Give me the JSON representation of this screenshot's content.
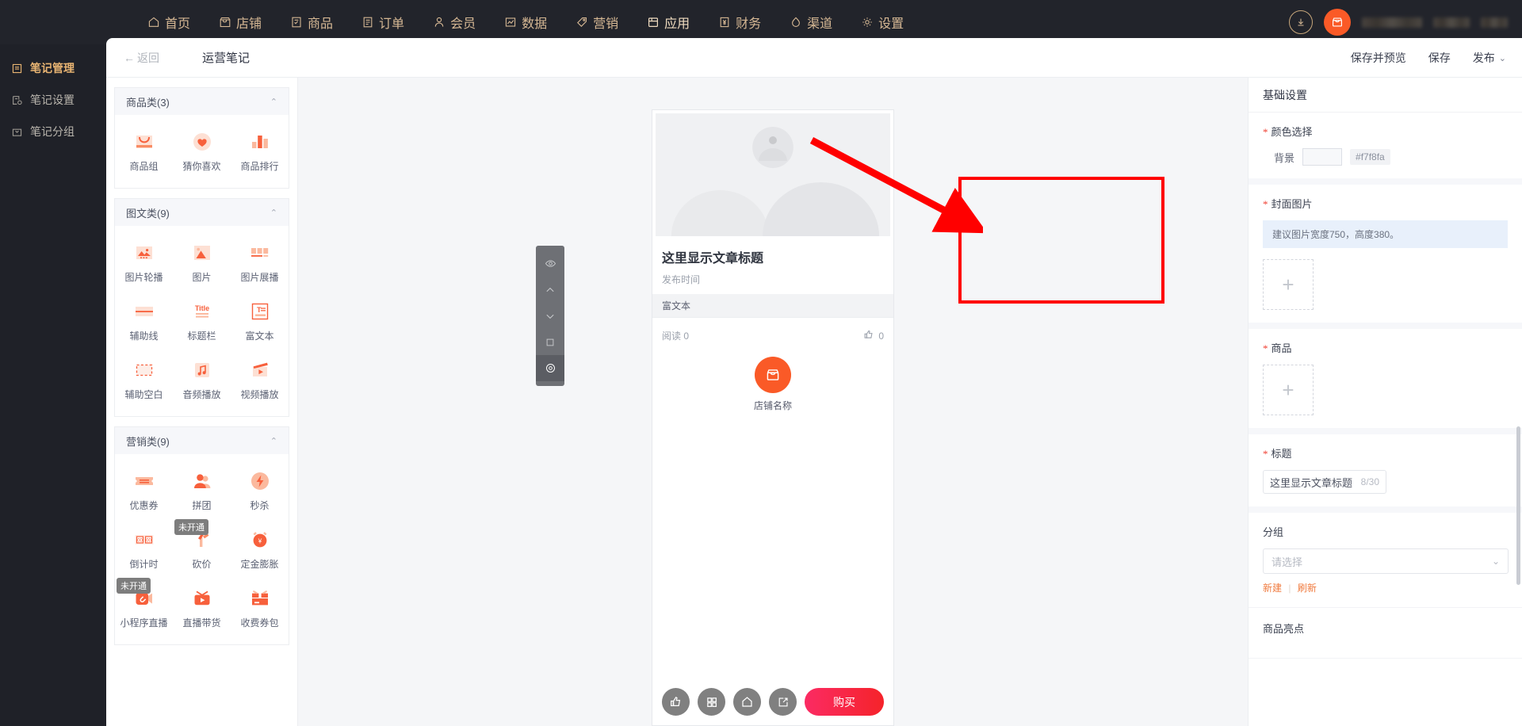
{
  "topnav": {
    "items": [
      {
        "label": "首页",
        "icon": "home-icon",
        "active": false
      },
      {
        "label": "店铺",
        "icon": "store-icon",
        "active": false
      },
      {
        "label": "商品",
        "icon": "goods-icon",
        "active": false
      },
      {
        "label": "订单",
        "icon": "order-icon",
        "active": false
      },
      {
        "label": "会员",
        "icon": "member-icon",
        "active": false
      },
      {
        "label": "数据",
        "icon": "chart-icon",
        "active": false
      },
      {
        "label": "营销",
        "icon": "tag-icon",
        "active": false
      },
      {
        "label": "应用",
        "icon": "apps-icon",
        "active": true
      },
      {
        "label": "财务",
        "icon": "finance-icon",
        "active": false
      },
      {
        "label": "渠道",
        "icon": "channel-icon",
        "active": false
      },
      {
        "label": "设置",
        "icon": "gear-icon",
        "active": false
      }
    ],
    "download_icon": "download-icon",
    "avatar_icon": "store-avatar-icon"
  },
  "rail": {
    "items": [
      {
        "label": "笔记管理",
        "icon": "note-list-icon",
        "active": true
      },
      {
        "label": "笔记设置",
        "icon": "note-settings-icon",
        "active": false
      },
      {
        "label": "笔记分组",
        "icon": "note-group-icon",
        "active": false
      }
    ]
  },
  "header": {
    "back_label": "返回",
    "title": "运营笔记",
    "save_preview_label": "保存并预览",
    "save_label": "保存",
    "publish_label": "发布"
  },
  "components": {
    "groups": [
      {
        "title": "商品类(3)",
        "collapse_icon": "chevron-up-icon",
        "items": [
          {
            "label": "商品组",
            "icon": "goods-group-icon",
            "badge": ""
          },
          {
            "label": "猜你喜欢",
            "icon": "heart-icon",
            "badge": ""
          },
          {
            "label": "商品排行",
            "icon": "bar-rank-icon",
            "badge": ""
          }
        ]
      },
      {
        "title": "图文类(9)",
        "collapse_icon": "chevron-up-icon",
        "items": [
          {
            "label": "图片轮播",
            "icon": "carousel-icon",
            "badge": ""
          },
          {
            "label": "图片",
            "icon": "image-icon",
            "badge": ""
          },
          {
            "label": "图片展播",
            "icon": "image-show-icon",
            "badge": ""
          },
          {
            "label": "辅助线",
            "icon": "divider-line-icon",
            "badge": ""
          },
          {
            "label": "标题栏",
            "icon": "title-bar-icon",
            "badge": ""
          },
          {
            "label": "富文本",
            "icon": "rich-text-icon",
            "badge": ""
          },
          {
            "label": "辅助空白",
            "icon": "blank-space-icon",
            "badge": ""
          },
          {
            "label": "音频播放",
            "icon": "audio-icon",
            "badge": ""
          },
          {
            "label": "视频播放",
            "icon": "video-icon",
            "badge": ""
          }
        ]
      },
      {
        "title": "营销类(9)",
        "collapse_icon": "chevron-up-icon",
        "items": [
          {
            "label": "优惠券",
            "icon": "coupon-icon",
            "badge": ""
          },
          {
            "label": "拼团",
            "icon": "group-buy-icon",
            "badge": ""
          },
          {
            "label": "秒杀",
            "icon": "flash-sale-icon",
            "badge": ""
          },
          {
            "label": "倒计时",
            "icon": "countdown-icon",
            "badge": ""
          },
          {
            "label": "砍价",
            "icon": "bargain-icon",
            "badge": "未开通"
          },
          {
            "label": "定金膨胀",
            "icon": "deposit-icon",
            "badge": ""
          },
          {
            "label": "小程序直播",
            "icon": "mini-live-icon",
            "badge": "未开通"
          },
          {
            "label": "直播带货",
            "icon": "live-sell-icon",
            "badge": ""
          },
          {
            "label": "收费券包",
            "icon": "paid-coupon-icon",
            "badge": ""
          }
        ]
      }
    ]
  },
  "preview": {
    "article_title": "这里显示文章标题",
    "publish_time_label": "发布时间",
    "rich_text_label": "富文本",
    "read_label": "阅读 0",
    "like_count": "0",
    "shop_name": "店铺名称",
    "buy_label": "购买",
    "bottom_icons": [
      "thumbs-up-icon",
      "grid-icon",
      "home-icon",
      "share-icon"
    ],
    "float_tools": [
      "eye-icon",
      "arrow-up-icon",
      "arrow-down-icon",
      "copy-icon",
      "settings-target-icon"
    ]
  },
  "settings": {
    "title": "基础设置",
    "color_section": {
      "label": "颜色选择",
      "bg_label": "背景",
      "hex": "#f7f8fa",
      "swatch_color": "#f7f8fa"
    },
    "cover_section": {
      "label": "封面图片",
      "tip": "建议图片宽度750，高度380。",
      "upload_icon": "plus-icon"
    },
    "goods_section": {
      "label": "商品",
      "upload_icon": "plus-icon"
    },
    "title_section": {
      "label": "标题",
      "value": "这里显示文章标题",
      "counter": "8/30"
    },
    "group_section": {
      "label": "分组",
      "placeholder": "请选择",
      "chevron_icon": "chevron-down-icon",
      "new_label": "新建",
      "refresh_label": "刷新"
    },
    "next_section_label": "商品亮点"
  },
  "annotation": {
    "accent": "#ff0000"
  }
}
